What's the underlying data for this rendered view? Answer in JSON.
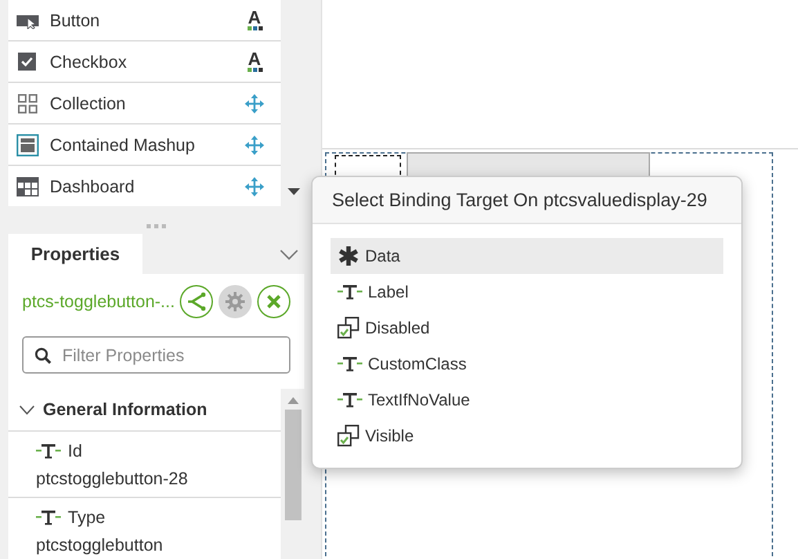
{
  "widgets": [
    {
      "label": "Button",
      "kind": "button",
      "badge": {
        "kind": "style",
        "text": "A"
      }
    },
    {
      "label": "Checkbox",
      "kind": "checkbox",
      "badge": {
        "kind": "style",
        "text": "A"
      }
    },
    {
      "label": "Collection",
      "kind": "collection",
      "badge": {
        "kind": "move"
      }
    },
    {
      "label": "Contained Mashup",
      "kind": "mashup",
      "badge": {
        "kind": "move"
      }
    },
    {
      "label": "Dashboard",
      "kind": "dashboard",
      "badge": {
        "kind": "move"
      }
    }
  ],
  "properties": {
    "tab": "Properties",
    "widget_name": "ptcs-togglebutton-...",
    "filter": {
      "placeholder": "Filter Properties"
    },
    "section": {
      "title": "General Information",
      "expanded": true
    },
    "rows": [
      {
        "name": "Id",
        "kind": "string",
        "value": "ptcstogglebutton-28"
      },
      {
        "name": "Type",
        "kind": "string",
        "value": "ptcstogglebutton"
      }
    ]
  },
  "popup": {
    "title": "Select Binding Target On ptcsvaluedisplay-29",
    "items": [
      {
        "label": "Data",
        "kind": "any",
        "selected": true
      },
      {
        "label": "Label",
        "kind": "string",
        "selected": false
      },
      {
        "label": "Disabled",
        "kind": "boolean",
        "selected": false
      },
      {
        "label": "CustomClass",
        "kind": "string",
        "selected": false
      },
      {
        "label": "TextIfNoValue",
        "kind": "string",
        "selected": false
      },
      {
        "label": "Visible",
        "kind": "boolean",
        "selected": false
      }
    ]
  }
}
